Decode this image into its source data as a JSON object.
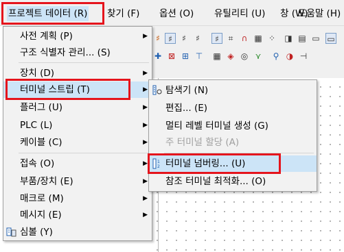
{
  "menubar": {
    "items": [
      {
        "label": "프로젝트 데이터 (R)"
      },
      {
        "label": "찾기 (F)"
      },
      {
        "label": "옵션 (O)"
      },
      {
        "label": "유틸리티 (U)"
      },
      {
        "label": "창 (W)"
      },
      {
        "label": "도움말 (H)"
      }
    ]
  },
  "project_menu": {
    "items": [
      {
        "label": "사전 계획 (P)"
      },
      {
        "label": "구조 식별자 관리... (S)"
      },
      {
        "label": "장치 (D)"
      },
      {
        "label": "터미널 스트립 (T)"
      },
      {
        "label": "플러그 (U)"
      },
      {
        "label": "PLC (L)"
      },
      {
        "label": "케이블 (C)"
      },
      {
        "label": "접속 (O)"
      },
      {
        "label": "부품/장치 (E)"
      },
      {
        "label": "매크로 (M)"
      },
      {
        "label": "메시지 (E)"
      },
      {
        "label": "심볼 (Y)"
      }
    ]
  },
  "terminal_submenu": {
    "items": [
      {
        "label": "탐색기 (N)"
      },
      {
        "label": "편집... (E)"
      },
      {
        "label": "멀티 레벨 터미널 생성 (G)"
      },
      {
        "label": "주 터미널 할당 (A)"
      },
      {
        "label": "터미널 넘버링... (U)"
      },
      {
        "label": "참조 터미널 최적화... (O)"
      }
    ]
  },
  "colors": {
    "highlight_border": "#e5141c",
    "hover_background": "#cce4f7",
    "menu_background": "#f2f2f2"
  }
}
